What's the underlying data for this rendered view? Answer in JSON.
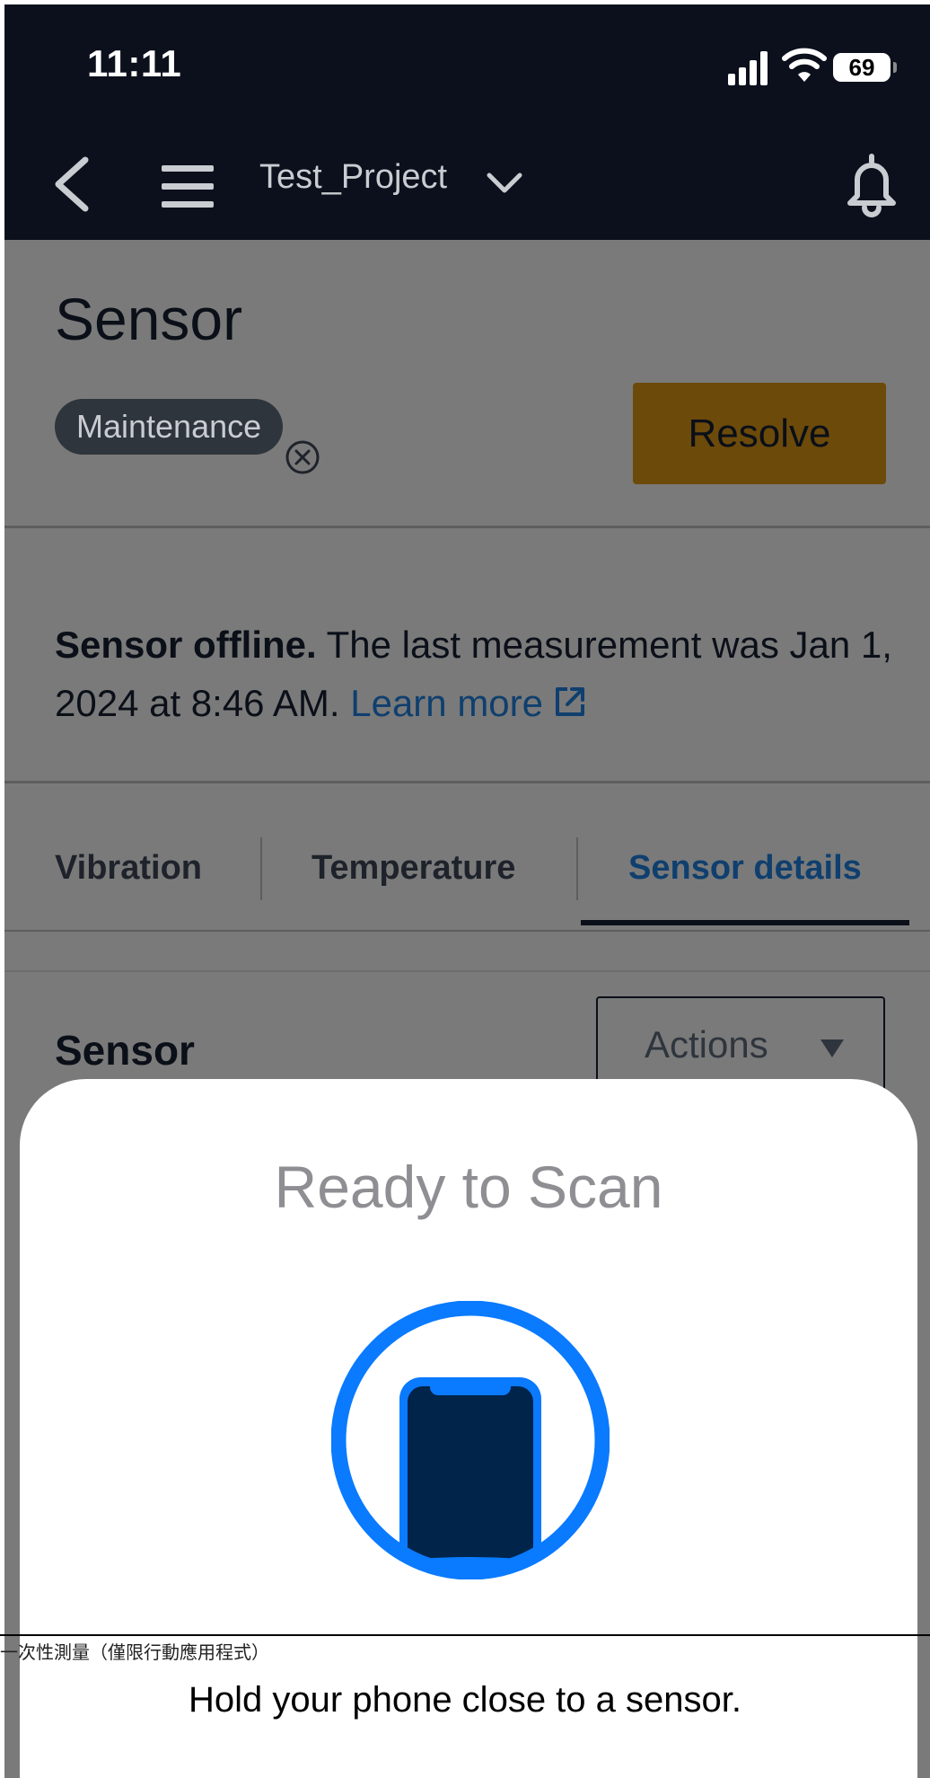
{
  "status_bar": {
    "time": "11:11",
    "battery": "69"
  },
  "nav": {
    "project": "Test_Project"
  },
  "header": {
    "title": "Sensor",
    "badge": "Maintenance",
    "resolve_label": "Resolve"
  },
  "alert": {
    "bold": "Sensor offline.",
    "text": " The last measurement was Jan 1, 2024 at 8:46 AM. ",
    "link": "Learn more"
  },
  "tabs": [
    {
      "label": "Vibration",
      "active": false
    },
    {
      "label": "Temperature",
      "active": false
    },
    {
      "label": "Sensor details",
      "active": true
    }
  ],
  "section": {
    "title": "Sensor",
    "actions_label": "Actions"
  },
  "scan_sheet": {
    "title": "Ready to Scan",
    "message": "Hold your phone close to a sensor.",
    "overlay_label": "一次性測量（僅限行動應用程式）"
  },
  "colors": {
    "nav_background": "#0b101c",
    "resolve_button": "#6c4a0a",
    "scan_ring": "#0a7aff",
    "phone_body": "#01244a",
    "sheet_title": "#8e8e93"
  },
  "icons": [
    "back-chevron-icon",
    "hamburger-menu-icon",
    "chevron-down-icon",
    "bell-icon",
    "close-circle-icon",
    "external-link-icon",
    "caret-down-icon",
    "phone-nfc-icon"
  ]
}
